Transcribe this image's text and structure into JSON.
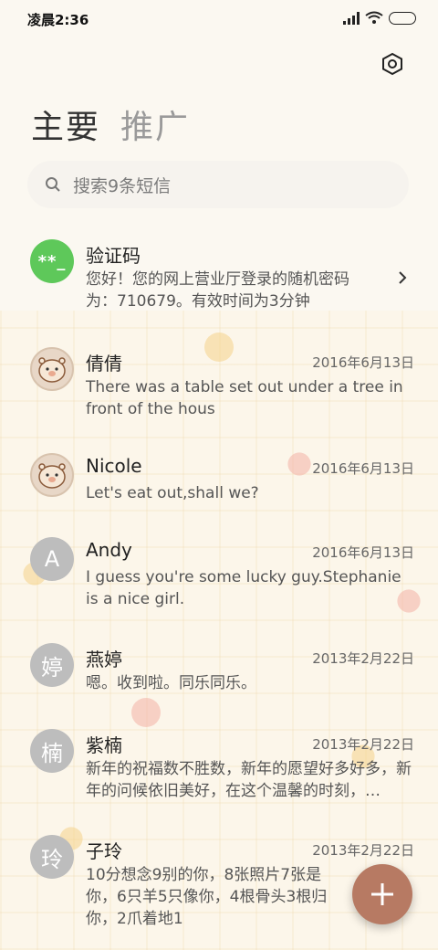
{
  "status_bar": {
    "time": "凌晨2:36"
  },
  "tabs": [
    {
      "label": "主要"
    },
    {
      "label": "推广"
    }
  ],
  "search": {
    "placeholder": "搜索9条短信"
  },
  "conversations": [
    {
      "name": "验证码",
      "date": "",
      "avatar_text": "**_",
      "avatar_type": "green",
      "message": "您好！您的网上营业厅登录的随机密码为：710679。有效时间为3分钟"
    },
    {
      "name": "倩倩",
      "date": "2016年6月13日",
      "avatar_text": "",
      "avatar_type": "hamster",
      "message": "There was a table set out under a tree in front of the hous"
    },
    {
      "name": "Nicole",
      "date": "2016年6月13日",
      "avatar_text": "",
      "avatar_type": "hamster",
      "message": "Let's eat out,shall we?"
    },
    {
      "name": "Andy",
      "date": "2016年6月13日",
      "avatar_text": "A",
      "avatar_type": "gray",
      "message": "I guess you're some lucky guy.Stephanie is a nice girl."
    },
    {
      "name": "燕婷",
      "date": "2013年2月22日",
      "avatar_text": "婷",
      "avatar_type": "gray",
      "message": "嗯。收到啦。同乐同乐。"
    },
    {
      "name": "紫楠",
      "date": "2013年2月22日",
      "avatar_text": "楠",
      "avatar_type": "gray",
      "message": "新年的祝福数不胜数，新年的愿望好多好多，新年的问候依旧美好，在这个温馨的时刻，…"
    },
    {
      "name": "子玲",
      "date": "2013年2月22日",
      "avatar_text": "玲",
      "avatar_type": "gray",
      "message": "10分想念9别的你，8张照片7张是你，6只羊5只像你，4根骨头3根归你，2爪着地1"
    }
  ],
  "colors": {
    "fab": "#b77a63",
    "green_avatar": "#5ec85a",
    "gray_avatar": "#bdbdbd"
  }
}
